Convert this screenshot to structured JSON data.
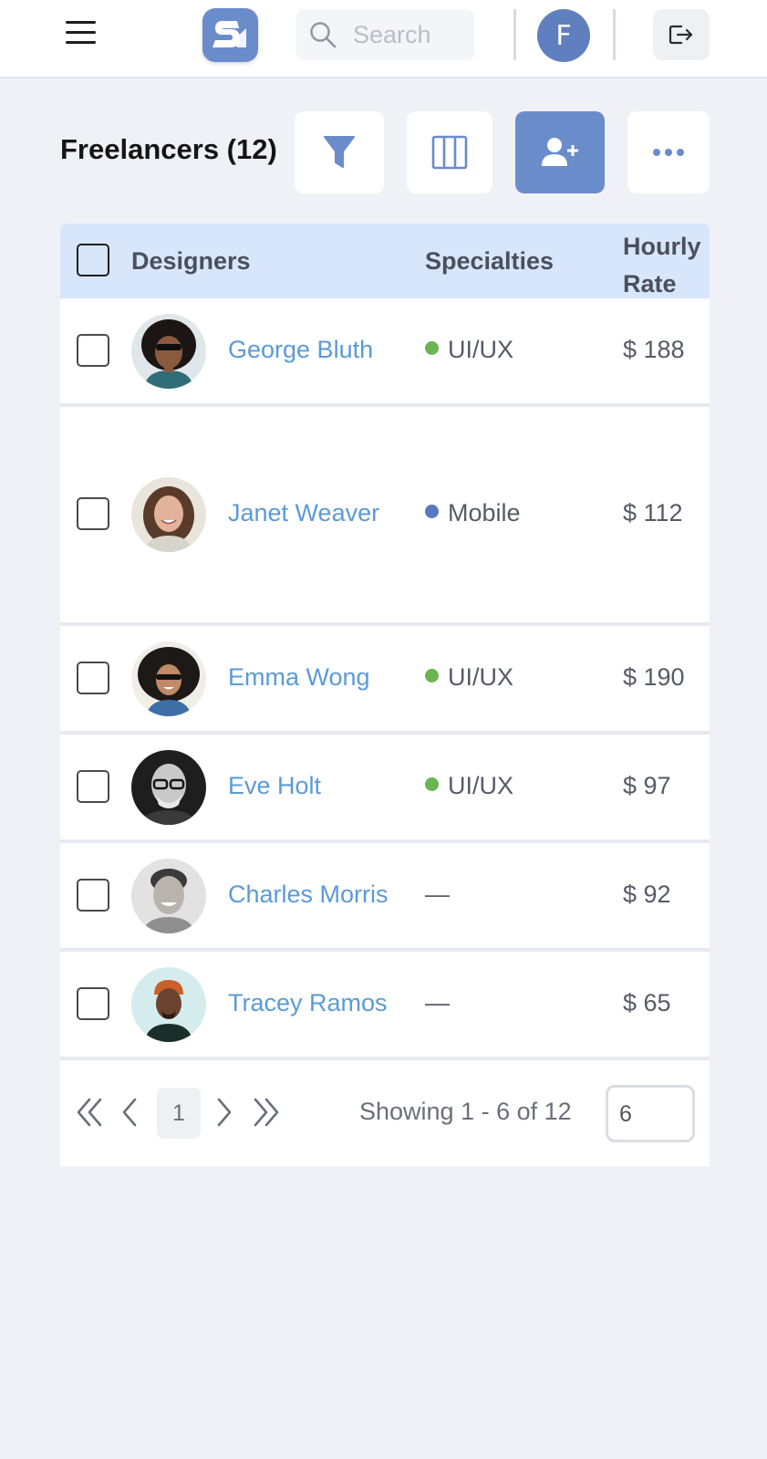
{
  "header": {
    "search_placeholder": "Search",
    "user_initial": "F"
  },
  "toolbar": {
    "title": "Freelancers (12)",
    "icons": [
      "filter-icon",
      "columns-icon",
      "add-user-icon",
      "more-icon"
    ]
  },
  "table": {
    "headers": {
      "designers": "Designers",
      "specialties": "Specialties",
      "rate": "Hourly\nRate"
    },
    "rows": [
      {
        "name": "George Bluth",
        "specialty": "UI/UX",
        "rate": "$ 188",
        "dot": "#6ab552"
      },
      {
        "name": "Janet Weaver",
        "specialty": "Mobile",
        "rate": "$ 112",
        "dot": "#5a78c2"
      },
      {
        "name": "Emma Wong",
        "specialty": "UI/UX",
        "rate": "$ 190",
        "dot": "#6ab552"
      },
      {
        "name": "Eve Holt",
        "specialty": "UI/UX",
        "rate": "$ 97",
        "dot": "#6ab552"
      },
      {
        "name": "Charles Morris",
        "specialty": "—",
        "rate": "$ 92",
        "dot": ""
      },
      {
        "name": "Tracey Ramos",
        "specialty": "—",
        "rate": "$ 65",
        "dot": ""
      }
    ]
  },
  "pagination": {
    "current_page": "1",
    "showing": "Showing 1 - 6 of 12",
    "page_size": "6"
  },
  "colors": {
    "accent": "#6b8ccb",
    "link": "#5b9ad9",
    "header_bg": "#d8e6fb",
    "page_bg": "#eff1f6"
  }
}
